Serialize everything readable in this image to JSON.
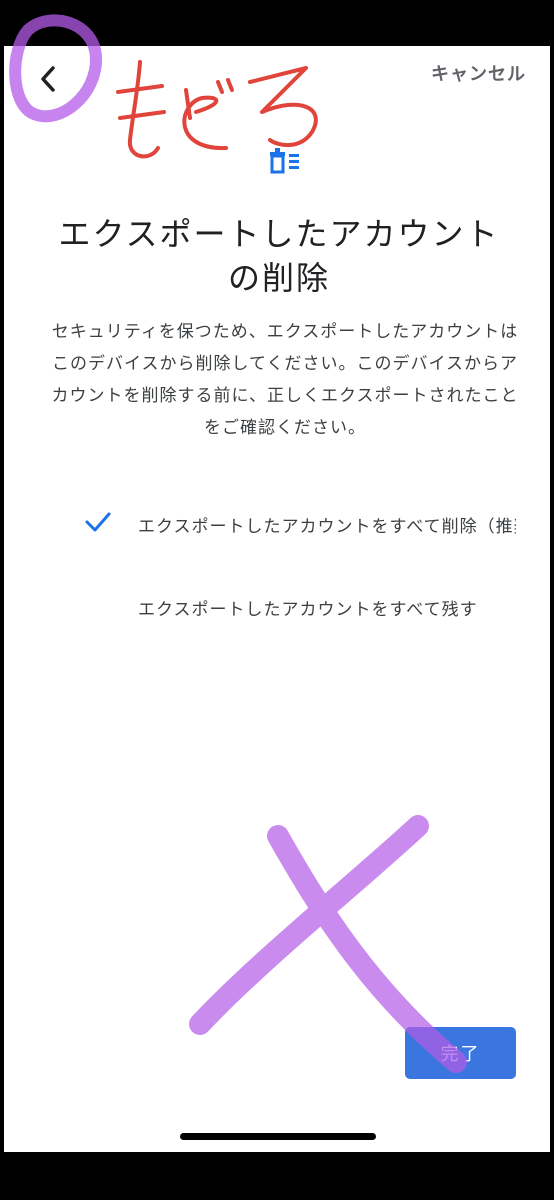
{
  "header": {
    "back_icon": "chevron-left-icon",
    "cancel_label": "キャンセル"
  },
  "main": {
    "icon": "trash-list-icon",
    "title_line1": "エクスポートしたアカウント",
    "title_line2": "の削除",
    "description": "セキュリティを保つため、エクスポートしたアカウントはこのデバイスから削除してください。このデバイスからアカウントを削除する前に、正しくエクスポートされたことをご確認ください。",
    "options": [
      {
        "label": "エクスポートしたアカウントをすべて削除（推奨）",
        "selected": true
      },
      {
        "label": "エクスポートしたアカウントをすべて残す",
        "selected": false
      }
    ],
    "done_label": "完了"
  },
  "annotations": {
    "handwritten_text": "もどる",
    "red_color": "#e0443a",
    "purple_color": "#b45be8"
  },
  "colors": {
    "accent": "#3b76e0",
    "icon_blue": "#1a73e8"
  }
}
